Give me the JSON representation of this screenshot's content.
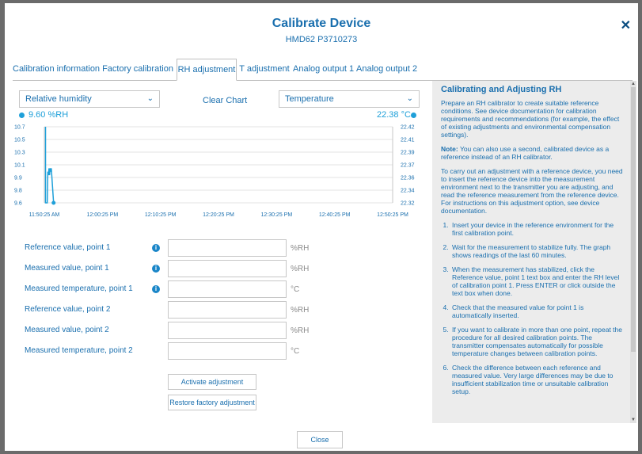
{
  "dialog": {
    "title": "Calibrate Device",
    "subtitle": "HMD62 P3710273",
    "close_icon": "close-icon",
    "close_glyph": "✕",
    "close_button_label": "Close"
  },
  "tabs": [
    {
      "label": "Calibration information",
      "active": false
    },
    {
      "label": "Factory calibration",
      "active": false
    },
    {
      "label": "RH adjustment",
      "active": true
    },
    {
      "label": "T adjustment",
      "active": false
    },
    {
      "label": "Analog output 1",
      "active": false
    },
    {
      "label": "Analog output 2",
      "active": false
    }
  ],
  "chart_controls": {
    "left_select": "Relative humidity",
    "right_select": "Temperature",
    "clear_chart": "Clear Chart",
    "chevron_glyph": "⌄"
  },
  "readouts": {
    "rh": "9.60 %RH",
    "temp": "22.38 °C"
  },
  "chart_data": {
    "type": "line",
    "title": "",
    "x_ticks": [
      "11:50:25 AM",
      "12:00:25 PM",
      "12:10:25 PM",
      "12:20:25 PM",
      "12:30:25 PM",
      "12:40:25 PM",
      "12:50:25 PM"
    ],
    "y_left_ticks": [
      "10.7",
      "10.5",
      "10.3",
      "10.1",
      "9.9",
      "9.8",
      "9.6"
    ],
    "y_right_ticks": [
      "22.42",
      "22.41",
      "22.39",
      "22.37",
      "22.36",
      "22.34",
      "22.32"
    ],
    "series": [
      {
        "name": "Relative humidity",
        "color": "#1fa0d9",
        "unit": "%RH",
        "points": [
          [
            0.2,
            10.7
          ],
          [
            0.2,
            9.6
          ],
          [
            0.5,
            9.6
          ],
          [
            0.6,
            10.05
          ],
          [
            0.7,
            10.0
          ],
          [
            0.8,
            10.1
          ],
          [
            0.9,
            10.0
          ],
          [
            1.0,
            10.1
          ],
          [
            1.1,
            10.05
          ],
          [
            1.2,
            10.1
          ],
          [
            1.6,
            9.6
          ]
        ]
      }
    ],
    "x_unit": "minutes since 11:50:25 AM",
    "x_range": [
      0,
      60
    ],
    "y_left_range": [
      9.6,
      10.7
    ],
    "grid": true
  },
  "fields": [
    {
      "label": "Reference value, point 1",
      "unit": "%RH",
      "value": "",
      "info": true
    },
    {
      "label": "Measured value, point 1",
      "unit": "%RH",
      "value": "",
      "info": true
    },
    {
      "label": "Measured temperature, point 1",
      "unit": "°C",
      "value": "",
      "info": true
    },
    {
      "label": "Reference value, point 2",
      "unit": "%RH",
      "value": "",
      "info": false
    },
    {
      "label": "Measured value, point 2",
      "unit": "%RH",
      "value": "",
      "info": false
    },
    {
      "label": "Measured temperature, point 2",
      "unit": "°C",
      "value": "",
      "info": false
    }
  ],
  "buttons": {
    "activate": "Activate adjustment",
    "restore": "Restore factory adjustment",
    "info_glyph": "i"
  },
  "help": {
    "title": "Calibrating and Adjusting RH",
    "p1": "Prepare an RH calibrator to create suitable reference conditions. See device documentation for calibration requirements and recommendations (for example, the effect of existing adjustments and environmental compensation settings).",
    "note_label": "Note:",
    "note_text": " You can also use a second, calibrated device as a reference instead of an RH calibrator.",
    "p3": "To carry out an adjustment with a reference device, you need to insert the reference device into the measurement environment next to the transmitter you are adjusting, and read the reference measurement from the reference device. For instructions on this adjustment option, see device documentation.",
    "steps": [
      "Insert your device in the reference environment for the first calibration point.",
      "Wait for the measurement to stabilize fully. The graph shows readings of the last 60 minutes.",
      "When the measurement has stabilized, click the Reference value, point 1 text box and enter the RH level of calibration point 1. Press ENTER or click outside the text box when done.",
      "Check that the measured value for point 1 is automatically inserted.",
      "If you want to calibrate in more than one point, repeat the procedure for all desired calibration points. The transmitter compensates automatically for possible temperature changes between calibration points.",
      "Check the difference between each reference and measured value. Very large differences may be due to insufficient stabilization time or unsuitable calibration setup."
    ],
    "scroll_up": "▲",
    "scroll_down": "▼"
  }
}
